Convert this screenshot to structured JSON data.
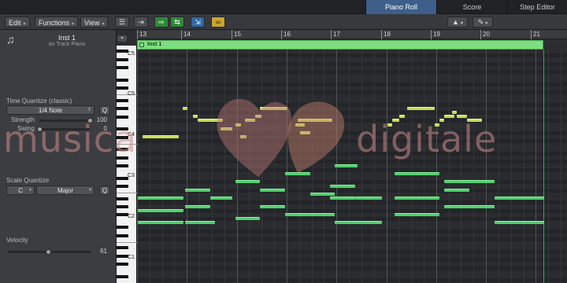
{
  "tabs": [
    {
      "label": "Piano Roll",
      "active": true
    },
    {
      "label": "Score",
      "active": false
    },
    {
      "label": "Step Editor",
      "active": false
    }
  ],
  "toolbar": {
    "edit_label": "Edit",
    "functions_label": "Functions",
    "view_label": "View",
    "buttons": [
      {
        "icon": "quantize-lines-icon",
        "glyph": "☰"
      },
      {
        "icon": "collapse-icon",
        "glyph": "⇥"
      },
      {
        "icon": "midi-in-icon",
        "glyph": "⇨"
      },
      {
        "icon": "midi-out-icon",
        "glyph": "⇆"
      },
      {
        "icon": "link-icon",
        "glyph": "∞"
      }
    ],
    "pointer_tool_glyph": "▲",
    "pencil_tool_glyph": "✎",
    "caret": "▾"
  },
  "inspector": {
    "region_name": "Inst 1",
    "region_sub": "on Track Piano",
    "collapse_glyph": "▾",
    "time_quantize": {
      "label": "Time Quantize (classic)",
      "value": "1/4 Note",
      "q": "Q",
      "strength_label": "Strength",
      "strength_value": "100",
      "strength_fraction": 1.0,
      "swing_label": "Swing",
      "swing_value": "0",
      "swing_fraction": 0.0
    },
    "scale_quantize": {
      "label": "Scale Quantize",
      "root": "C",
      "mode": "Major",
      "q": "Q"
    },
    "velocity": {
      "label": "Velocity",
      "value": "61",
      "fraction": 0.48
    }
  },
  "ruler": {
    "bars": [
      "13",
      "14",
      "15",
      "16",
      "17",
      "18",
      "19",
      "20",
      "21"
    ]
  },
  "region": {
    "name": "Inst 1"
  },
  "keyboard": {
    "octave_labels": [
      "C5",
      "C4",
      "C3",
      "C2",
      "C1"
    ]
  },
  "watermark": {
    "left": "musica",
    "right": "digitale"
  },
  "notes": [
    {
      "bar": 13.15,
      "len": 0.72,
      "row": 21,
      "color": "yellow"
    },
    {
      "bar": 13.05,
      "len": 0.92,
      "row": 36,
      "color": "green"
    },
    {
      "bar": 13.05,
      "len": 0.92,
      "row": 39,
      "color": "green"
    },
    {
      "bar": 13.05,
      "len": 0.92,
      "row": 42,
      "color": "green"
    },
    {
      "bar": 14.0,
      "len": 0.5,
      "row": 34,
      "color": "green"
    },
    {
      "bar": 14.0,
      "len": 0.5,
      "row": 38,
      "color": "green"
    },
    {
      "bar": 14.5,
      "len": 0.45,
      "row": 36,
      "color": "green"
    },
    {
      "bar": 14.0,
      "len": 0.6,
      "row": 42,
      "color": "green"
    },
    {
      "bar": 13.95,
      "len": 0.1,
      "row": 14,
      "color": "yellow"
    },
    {
      "bar": 14.15,
      "len": 0.1,
      "row": 16,
      "color": "yellow"
    },
    {
      "bar": 14.25,
      "len": 0.5,
      "row": 17,
      "color": "yellow"
    },
    {
      "bar": 14.7,
      "len": 0.25,
      "row": 19,
      "color": "yellow"
    },
    {
      "bar": 15.0,
      "len": 0.12,
      "row": 18,
      "color": "yellow"
    },
    {
      "bar": 15.1,
      "len": 0.12,
      "row": 21,
      "color": "yellow"
    },
    {
      "bar": 15.2,
      "len": 0.2,
      "row": 17,
      "color": "yellow"
    },
    {
      "bar": 15.4,
      "len": 0.12,
      "row": 16,
      "color": "yellow"
    },
    {
      "bar": 15.5,
      "len": 0.55,
      "row": 14,
      "color": "yellow"
    },
    {
      "bar": 15.0,
      "len": 0.5,
      "row": 32,
      "color": "green"
    },
    {
      "bar": 15.0,
      "len": 0.5,
      "row": 41,
      "color": "green"
    },
    {
      "bar": 15.5,
      "len": 0.5,
      "row": 34,
      "color": "green"
    },
    {
      "bar": 15.5,
      "len": 0.5,
      "row": 38,
      "color": "green"
    },
    {
      "bar": 16.0,
      "len": 0.5,
      "row": 30,
      "color": "green"
    },
    {
      "bar": 16.0,
      "len": 1.0,
      "row": 40,
      "color": "green"
    },
    {
      "bar": 16.2,
      "len": 0.2,
      "row": 18,
      "color": "yellow"
    },
    {
      "bar": 16.3,
      "len": 0.2,
      "row": 20,
      "color": "yellow"
    },
    {
      "bar": 16.25,
      "len": 0.7,
      "row": 17,
      "color": "yellow"
    },
    {
      "bar": 16.5,
      "len": 0.5,
      "row": 35,
      "color": "green"
    },
    {
      "bar": 16.9,
      "len": 0.5,
      "row": 33,
      "color": "green"
    },
    {
      "bar": 16.9,
      "len": 0.5,
      "row": 36,
      "color": "green"
    },
    {
      "bar": 17.0,
      "len": 0.45,
      "row": 28,
      "color": "green"
    },
    {
      "bar": 17.0,
      "len": 0.95,
      "row": 42,
      "color": "green"
    },
    {
      "bar": 17.4,
      "len": 0.55,
      "row": 36,
      "color": "green"
    },
    {
      "bar": 18.05,
      "len": 0.1,
      "row": 18,
      "color": "yellow"
    },
    {
      "bar": 18.15,
      "len": 0.15,
      "row": 17,
      "color": "yellow"
    },
    {
      "bar": 18.3,
      "len": 0.1,
      "row": 16,
      "color": "yellow"
    },
    {
      "bar": 18.45,
      "len": 0.55,
      "row": 14,
      "color": "yellow"
    },
    {
      "bar": 18.2,
      "len": 0.9,
      "row": 30,
      "color": "green"
    },
    {
      "bar": 18.2,
      "len": 0.9,
      "row": 36,
      "color": "green"
    },
    {
      "bar": 18.2,
      "len": 0.9,
      "row": 40,
      "color": "green"
    },
    {
      "bar": 19.0,
      "len": 0.1,
      "row": 18,
      "color": "yellow"
    },
    {
      "bar": 19.1,
      "len": 0.1,
      "row": 17,
      "color": "yellow"
    },
    {
      "bar": 19.2,
      "len": 0.2,
      "row": 16,
      "color": "yellow"
    },
    {
      "bar": 19.35,
      "len": 0.1,
      "row": 15,
      "color": "yellow"
    },
    {
      "bar": 19.45,
      "len": 0.2,
      "row": 16,
      "color": "yellow"
    },
    {
      "bar": 19.65,
      "len": 0.3,
      "row": 17,
      "color": "yellow"
    },
    {
      "bar": 19.2,
      "len": 1.0,
      "row": 32,
      "color": "green"
    },
    {
      "bar": 19.2,
      "len": 1.0,
      "row": 38,
      "color": "green"
    },
    {
      "bar": 19.2,
      "len": 0.5,
      "row": 34,
      "color": "green"
    },
    {
      "bar": 20.2,
      "len": 1.0,
      "row": 36,
      "color": "green"
    },
    {
      "bar": 20.2,
      "len": 1.0,
      "row": 42,
      "color": "green"
    }
  ]
}
